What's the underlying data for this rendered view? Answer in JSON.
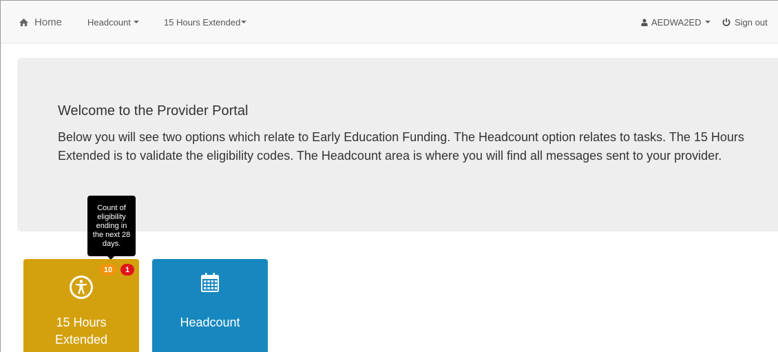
{
  "navbar": {
    "home_label": "Home",
    "headcount_label": "Headcount",
    "hours_label": "15 Hours Extended",
    "user_label": "AEDWA2ED",
    "signout_label": "Sign out"
  },
  "jumbotron": {
    "title": "Welcome to the Provider Portal",
    "text": "Below you will see two options which relate to Early Education Funding. The Headcount option relates to tasks. The 15 Hours Extended is to validate the eligibility codes. The Headcount area is where you will find all messages sent to your provider."
  },
  "tooltip": {
    "text": "Count of eligibility ending in the next 28 days."
  },
  "tiles": [
    {
      "label_line1": "15 Hours",
      "label_line2": "Extended",
      "icon": "accessibility-icon",
      "color": "#d3a10e",
      "badge_count": "10",
      "badge_alert": "1"
    },
    {
      "label": "Headcount",
      "icon": "calendar-icon",
      "color": "#1788bf"
    }
  ],
  "colors": {
    "badge_orange": "#f0940e",
    "badge_red": "#e0151b"
  }
}
